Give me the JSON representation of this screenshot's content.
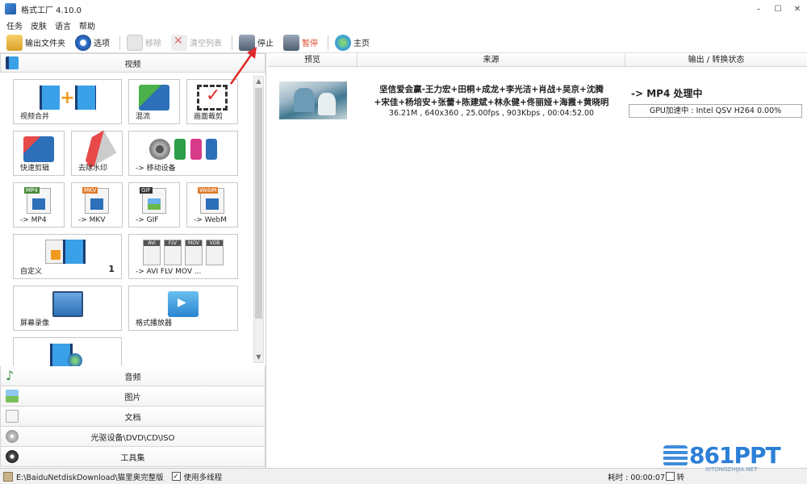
{
  "window": {
    "title": "格式工厂 4.10.0",
    "min": "–",
    "max": "☐",
    "close": "✕"
  },
  "menu": [
    "任务",
    "皮肤",
    "语言",
    "帮助"
  ],
  "toolbar": {
    "output_folder": "输出文件夹",
    "options": "选项",
    "remove": "移除",
    "clear_list": "清空列表",
    "stop": "停止",
    "pause": "暂停",
    "home": "主页"
  },
  "left": {
    "video_header": "视频",
    "tiles": {
      "merge": "视频合并",
      "mix": "混流",
      "crop": "画面裁剪",
      "quick_cut": "快速剪辑",
      "watermark": "去除水印",
      "mobile": "-> 移动设备",
      "mp4": "-> MP4",
      "mkv": "-> MKV",
      "gif": "-> GIF",
      "webm": "-> WebM",
      "custom": "自定义",
      "custom_count": "1",
      "avi": "-> AVI FLV MOV ...",
      "screen_record": "屏幕录像",
      "player": "格式播放器"
    },
    "badges": {
      "mp4": "MP4",
      "mkv": "MKV",
      "gif": "GIF",
      "webm": "WebM",
      "avi": "AVI",
      "flv": "FLV",
      "mov": "MOV",
      "vob": "VOB"
    },
    "categories": [
      "音频",
      "图片",
      "文档",
      "光驱设备\\DVD\\CD\\ISO",
      "工具集"
    ]
  },
  "table": {
    "headers": {
      "preview": "预览",
      "source": "来源",
      "output": "输出 / 转换状态"
    },
    "task": {
      "title_line1": "坚信爱会赢-王力宏+田桐+成龙+李光洁+肖战+吴京+沈腾",
      "title_line2": "+宋佳+杨培安+张蕾+陈建斌+林永健+佟丽娅+海霞+黄晓明",
      "meta": "36.21M , 640x360 , 25.00fps , 903Kbps , 00:04:52.00",
      "status": "-> MP4 处理中",
      "progress": "GPU加速中 : Intel QSV H264 0.00%",
      "progress_value": 0
    }
  },
  "statusbar": {
    "path": "E:\\BaiduNetdiskDownload\\猫里奥完整版",
    "multithread": "使用多线程",
    "check": "✓",
    "elapsed": "耗时 : 00:00:07",
    "after": "转"
  },
  "watermark": {
    "logo": "861PPT",
    "sub": "XITONGZHIJIA.NET"
  },
  "colors": {
    "accent": "#2b7fd8",
    "pause": "#d94c2a",
    "annotation_arrow": "#e02a2a"
  }
}
